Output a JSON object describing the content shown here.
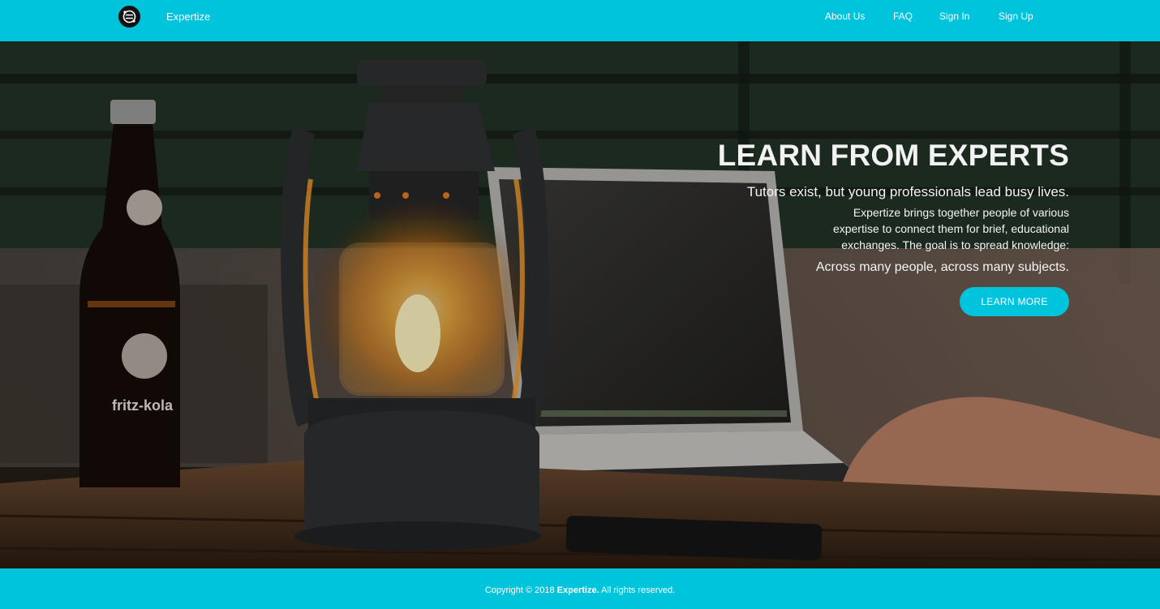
{
  "nav": {
    "brand": "Expertize",
    "links": [
      "About Us",
      "FAQ",
      "Sign In",
      "Sign Up"
    ]
  },
  "hero": {
    "title": "LEARN FROM EXPERTS",
    "lead": "Tutors exist, but young professionals lead busy lives.",
    "body_lines": [
      "Expertize brings together people of various",
      "expertise to connect them for brief, educational",
      "exchanges. The goal is to spread knowledge:"
    ],
    "tagline": "Across many people, across many subjects.",
    "cta_label": "LEARN MORE",
    "image_labels": {
      "bottle": "fritz-kola"
    }
  },
  "footer": {
    "prefix": "Copyright © 2018",
    "brand": "Expertize.",
    "suffix": "All rights reserved."
  },
  "colors": {
    "accent": "#00c3dc",
    "text": "#ffffff"
  },
  "icons": [
    "logo-icon"
  ]
}
